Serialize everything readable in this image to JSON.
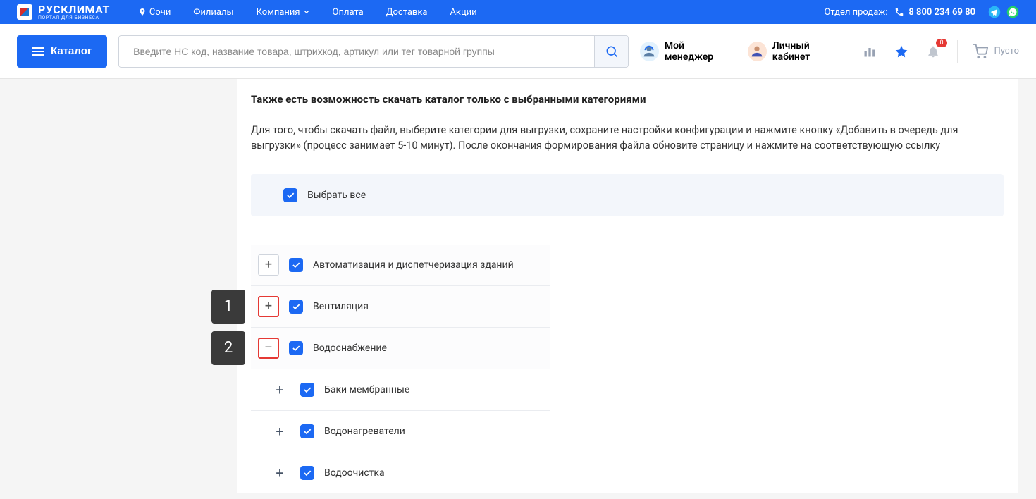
{
  "colors": {
    "primary": "#1c69f3",
    "danger": "#e53935"
  },
  "topbar": {
    "logo_main": "РУСКЛИМАТ",
    "logo_sub": "ПОРТАЛ ДЛЯ БИЗНЕСА",
    "location": "Сочи",
    "nav": [
      "Филиалы",
      "Компания",
      "Оплата",
      "Доставка",
      "Акции"
    ],
    "sales_label": "Отдел продаж:",
    "phone": "8 800 234 69 80"
  },
  "header": {
    "catalog_label": "Каталог",
    "search_placeholder": "Введите НС код, название товара, штрихкод, артикул или тег товарной группы",
    "manager_label": "Мой менеджер",
    "account_label": "Личный кабинет",
    "bell_badge": "0",
    "cart_label": "Пусто"
  },
  "content": {
    "heading": "Также есть возможность скачать каталог только с выбранными категориями",
    "description": "Для того, чтобы скачать файл, выберите категории для выгрузки, сохраните настройки конфигурации и нажмите кнопку «Добавить в очередь для выгрузки» (процесс занимает 5-10 минут). После окончания формирования файла обновите страницу и нажмите на соответствующую ссылку",
    "select_all": "Выбрать все",
    "callouts": {
      "one": "1",
      "two": "2"
    },
    "categories": [
      {
        "label": "Автоматизация и диспетчеризация зданий",
        "expand": "+"
      },
      {
        "label": "Вентиляция",
        "expand": "+"
      },
      {
        "label": "Водоснабжение",
        "expand": "–"
      }
    ],
    "subcategories": [
      {
        "label": "Баки мембранные",
        "expand": "+"
      },
      {
        "label": "Водонагреватели",
        "expand": "+"
      },
      {
        "label": "Водоочистка",
        "expand": "+"
      }
    ]
  }
}
